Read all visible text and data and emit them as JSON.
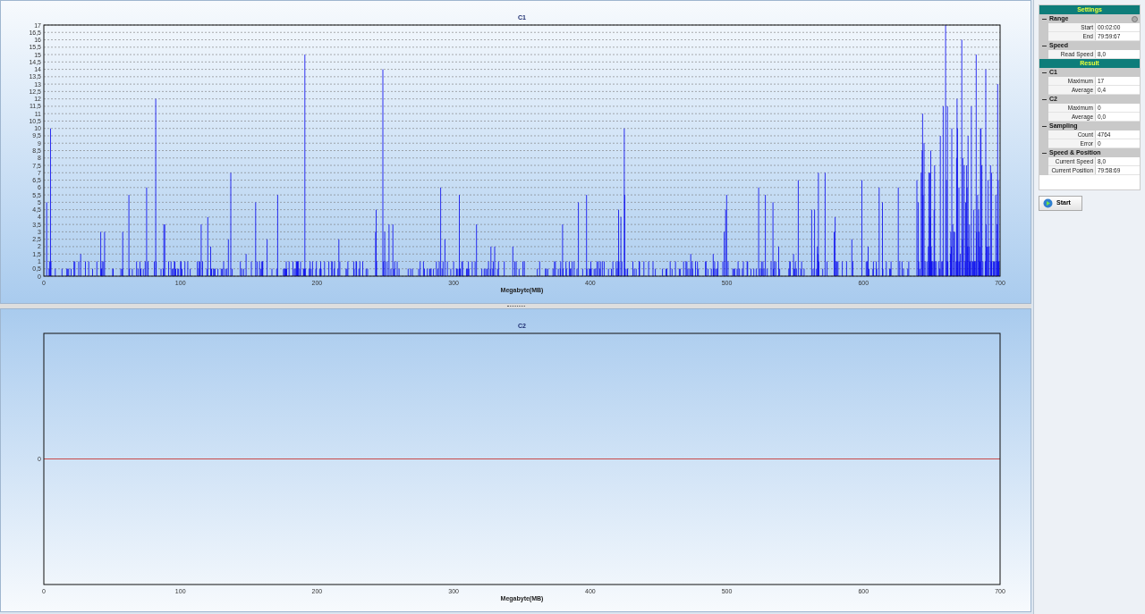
{
  "charts": [
    {
      "title": "C1",
      "kind": "spikes",
      "xlabel": "Megabyte(MB)",
      "x_ticks": [
        "0",
        "100",
        "200",
        "300",
        "400",
        "500",
        "600",
        "700"
      ],
      "y_ticks": [
        "17",
        "16,5",
        "16",
        "15,5",
        "15",
        "14,5",
        "14",
        "13,5",
        "13",
        "12,5",
        "12",
        "11,5",
        "11",
        "10,5",
        "10",
        "9,5",
        "9",
        "8,5",
        "8",
        "7,5",
        "7",
        "6,5",
        "6",
        "5,5",
        "5",
        "4,5",
        "4",
        "3,5",
        "3",
        "2,5",
        "2",
        "1,5",
        "1",
        "0,5",
        "0"
      ]
    },
    {
      "title": "C2",
      "kind": "flat",
      "xlabel": "Megabyte(MB)",
      "x_ticks": [
        "0",
        "100",
        "200",
        "300",
        "400",
        "500",
        "600",
        "700"
      ],
      "y_ticks": [
        "0"
      ]
    }
  ],
  "property_grid": [
    {
      "title": "Settings",
      "categories": [
        {
          "name": "Range",
          "expanded": true,
          "properties": [
            {
              "label": "Start",
              "value": "00:02:00"
            },
            {
              "label": "End",
              "value": "79:59:67"
            }
          ]
        },
        {
          "name": "Speed",
          "expanded": true,
          "properties": [
            {
              "label": "Read Speed",
              "value": "8,0"
            }
          ]
        }
      ]
    },
    {
      "title": "Result",
      "categories": [
        {
          "name": "C1",
          "expanded": true,
          "properties": [
            {
              "label": "Maximum",
              "value": "17"
            },
            {
              "label": "Average",
              "value": "0,4"
            }
          ]
        },
        {
          "name": "C2",
          "expanded": true,
          "properties": [
            {
              "label": "Maximum",
              "value": "0"
            },
            {
              "label": "Average",
              "value": "0,0"
            }
          ]
        },
        {
          "name": "Sampling",
          "expanded": true,
          "properties": [
            {
              "label": "Count",
              "value": "4764"
            },
            {
              "label": "Error",
              "value": "0"
            }
          ]
        },
        {
          "name": "Speed & Position",
          "expanded": true,
          "properties": [
            {
              "label": "Current Speed",
              "value": "8,0"
            },
            {
              "label": "Current Position",
              "value": "79:58:69"
            }
          ]
        }
      ]
    }
  ],
  "start_button": "Start"
}
